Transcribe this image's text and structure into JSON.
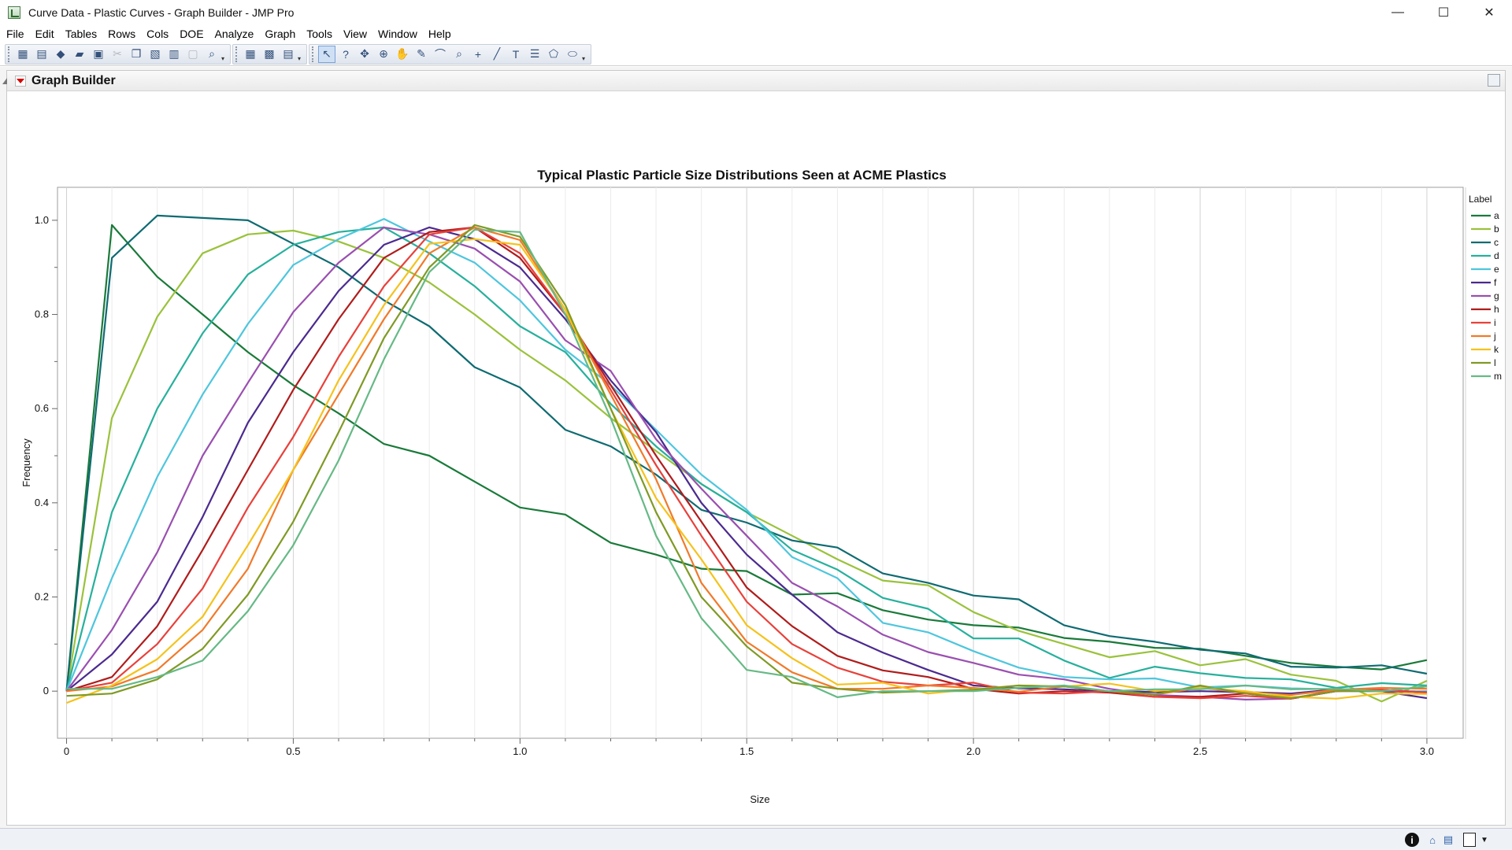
{
  "window": {
    "title": "Curve Data - Plastic Curves - Graph Builder - JMP Pro",
    "minimize": "—",
    "maximize": "☐",
    "close": "✕"
  },
  "menu": [
    "File",
    "Edit",
    "Tables",
    "Rows",
    "Cols",
    "DOE",
    "Analyze",
    "Graph",
    "Tools",
    "View",
    "Window",
    "Help"
  ],
  "panel": {
    "title": "Graph Builder"
  },
  "colors": {
    "a": "#1a7a3a",
    "b": "#9ac23c",
    "c": "#0f6b72",
    "d": "#27b09c",
    "e": "#4ec6dd",
    "f": "#4b2a8f",
    "g": "#9a4fb0",
    "h": "#b01c1c",
    "i": "#e8413b",
    "j": "#f07a2a",
    "k": "#f5c21c",
    "l": "#7f9a25",
    "m": "#66b985"
  },
  "chart_data": {
    "type": "line",
    "title": "Typical Plastic Particle Size Distributions Seen at ACME Plastics",
    "xlabel": "Size",
    "ylabel": "Frequency",
    "xlim": [
      -0.02,
      3.08
    ],
    "ylim": [
      -0.1,
      1.07
    ],
    "xticks": [
      "0",
      "0.5",
      "1.0",
      "1.5",
      "2.0",
      "2.5",
      "3.0"
    ],
    "yticks": [
      "0",
      "0.2",
      "0.4",
      "0.6",
      "0.8",
      "1.0"
    ],
    "legend_title": "Label",
    "legend_position": "right",
    "grid": "vertical",
    "x": [
      0,
      0.1,
      0.2,
      0.3,
      0.4,
      0.5,
      0.6,
      0.7,
      0.8,
      0.9,
      1.0,
      1.1,
      1.2,
      1.3,
      1.4,
      1.5,
      1.6,
      1.7,
      1.8,
      1.9,
      2.0,
      2.1,
      2.2,
      2.3,
      2.4,
      2.5,
      2.6,
      2.7,
      2.8,
      2.9,
      3.0
    ],
    "series": [
      {
        "name": "a",
        "values": [
          0.0,
          0.99,
          0.88,
          0.8,
          0.72,
          0.65,
          0.59,
          0.525,
          0.5,
          0.445,
          0.39,
          0.375,
          0.315,
          0.29,
          0.26,
          0.255,
          0.205,
          0.208,
          0.172,
          0.152,
          0.14,
          0.135,
          0.113,
          0.105,
          0.092,
          0.09,
          0.075,
          0.06,
          0.052,
          0.046,
          0.066
        ]
      },
      {
        "name": "b",
        "values": [
          0.0,
          0.58,
          0.795,
          0.93,
          0.97,
          0.978,
          0.955,
          0.92,
          0.868,
          0.8,
          0.725,
          0.66,
          0.58,
          0.51,
          0.44,
          0.38,
          0.33,
          0.28,
          0.235,
          0.225,
          0.168,
          0.128,
          0.1,
          0.072,
          0.085,
          0.055,
          0.068,
          0.035,
          0.022,
          -0.022,
          0.022
        ]
      },
      {
        "name": "c",
        "values": [
          0.0,
          0.92,
          1.01,
          1.005,
          1.0,
          0.95,
          0.9,
          0.83,
          0.775,
          0.688,
          0.645,
          0.555,
          0.52,
          0.46,
          0.385,
          0.358,
          0.32,
          0.305,
          0.25,
          0.23,
          0.203,
          0.195,
          0.14,
          0.117,
          0.105,
          0.088,
          0.08,
          0.052,
          0.05,
          0.055,
          0.037
        ]
      },
      {
        "name": "d",
        "values": [
          0.0,
          0.38,
          0.6,
          0.76,
          0.885,
          0.948,
          0.975,
          0.985,
          0.93,
          0.86,
          0.775,
          0.72,
          0.61,
          0.52,
          0.44,
          0.38,
          0.3,
          0.258,
          0.198,
          0.175,
          0.112,
          0.112,
          0.065,
          0.028,
          0.052,
          0.038,
          0.028,
          0.025,
          0.007,
          0.017,
          0.012
        ]
      },
      {
        "name": "e",
        "values": [
          0.0,
          0.24,
          0.455,
          0.63,
          0.78,
          0.905,
          0.96,
          1.003,
          0.955,
          0.91,
          0.83,
          0.725,
          0.65,
          0.555,
          0.46,
          0.385,
          0.285,
          0.24,
          0.145,
          0.125,
          0.085,
          0.05,
          0.03,
          0.025,
          0.027,
          0.008,
          0.012,
          0.006,
          0.004,
          0.0,
          0.0
        ]
      },
      {
        "name": "f",
        "values": [
          0.0,
          0.078,
          0.19,
          0.37,
          0.57,
          0.72,
          0.85,
          0.948,
          0.985,
          0.96,
          0.9,
          0.79,
          0.66,
          0.55,
          0.4,
          0.29,
          0.205,
          0.125,
          0.082,
          0.045,
          0.012,
          0.006,
          0.004,
          0.0,
          -0.002,
          0.0,
          -0.002,
          -0.005,
          0.004,
          0.0,
          -0.015
        ]
      },
      {
        "name": "g",
        "values": [
          0.0,
          0.13,
          0.295,
          0.5,
          0.655,
          0.805,
          0.91,
          0.985,
          0.97,
          0.94,
          0.87,
          0.745,
          0.68,
          0.535,
          0.43,
          0.33,
          0.23,
          0.18,
          0.12,
          0.083,
          0.06,
          0.035,
          0.025,
          0.005,
          -0.008,
          -0.012,
          -0.018,
          -0.016,
          0.0,
          0.0,
          -0.002
        ]
      },
      {
        "name": "h",
        "values": [
          0.0,
          0.03,
          0.138,
          0.3,
          0.47,
          0.64,
          0.79,
          0.92,
          0.975,
          0.985,
          0.92,
          0.8,
          0.65,
          0.5,
          0.36,
          0.22,
          0.138,
          0.075,
          0.044,
          0.03,
          0.005,
          -0.005,
          0.0,
          -0.003,
          -0.012,
          -0.012,
          -0.005,
          -0.016,
          0.0,
          0.003,
          -0.003
        ]
      },
      {
        "name": "i",
        "values": [
          0.0,
          0.018,
          0.1,
          0.218,
          0.39,
          0.54,
          0.71,
          0.86,
          0.97,
          0.985,
          0.93,
          0.8,
          0.64,
          0.48,
          0.33,
          0.19,
          0.1,
          0.05,
          0.02,
          0.012,
          0.018,
          -0.003,
          -0.005,
          0.0,
          -0.012,
          -0.015,
          -0.01,
          -0.016,
          0.002,
          0.003,
          -0.003
        ]
      },
      {
        "name": "j",
        "values": [
          0.0,
          0.01,
          0.045,
          0.13,
          0.26,
          0.47,
          0.63,
          0.79,
          0.93,
          0.985,
          0.958,
          0.81,
          0.63,
          0.45,
          0.23,
          0.105,
          0.04,
          0.005,
          0.005,
          0.012,
          0.007,
          -0.001,
          0.01,
          0.0,
          -0.007,
          0.007,
          -0.003,
          -0.008,
          0.003,
          0.007,
          0.005
        ]
      },
      {
        "name": "k",
        "values": [
          -0.025,
          0.012,
          0.068,
          0.158,
          0.31,
          0.47,
          0.66,
          0.82,
          0.95,
          0.96,
          0.948,
          0.81,
          0.6,
          0.41,
          0.28,
          0.14,
          0.07,
          0.014,
          0.018,
          -0.005,
          0.004,
          0.012,
          0.01,
          0.016,
          0.0,
          0.007,
          0.0,
          -0.012,
          -0.016,
          -0.005,
          -0.006
        ]
      },
      {
        "name": "l",
        "values": [
          -0.01,
          -0.005,
          0.025,
          0.09,
          0.205,
          0.36,
          0.55,
          0.75,
          0.9,
          0.99,
          0.965,
          0.82,
          0.6,
          0.38,
          0.2,
          0.095,
          0.018,
          0.005,
          -0.003,
          0.0,
          0.003,
          0.012,
          0.01,
          0.0,
          -0.007,
          0.012,
          -0.005,
          -0.015,
          0.0,
          0.0,
          0.01
        ]
      },
      {
        "name": "m",
        "values": [
          0.005,
          0.005,
          0.03,
          0.065,
          0.17,
          0.31,
          0.49,
          0.705,
          0.89,
          0.98,
          0.975,
          0.8,
          0.58,
          0.33,
          0.155,
          0.045,
          0.03,
          -0.013,
          0.0,
          0.0,
          0.0,
          0.007,
          0.012,
          0.0,
          0.004,
          0.004,
          0.012,
          0.004,
          0.005,
          0.0,
          0.01
        ]
      }
    ]
  },
  "status": {
    "info_icon": "i"
  }
}
